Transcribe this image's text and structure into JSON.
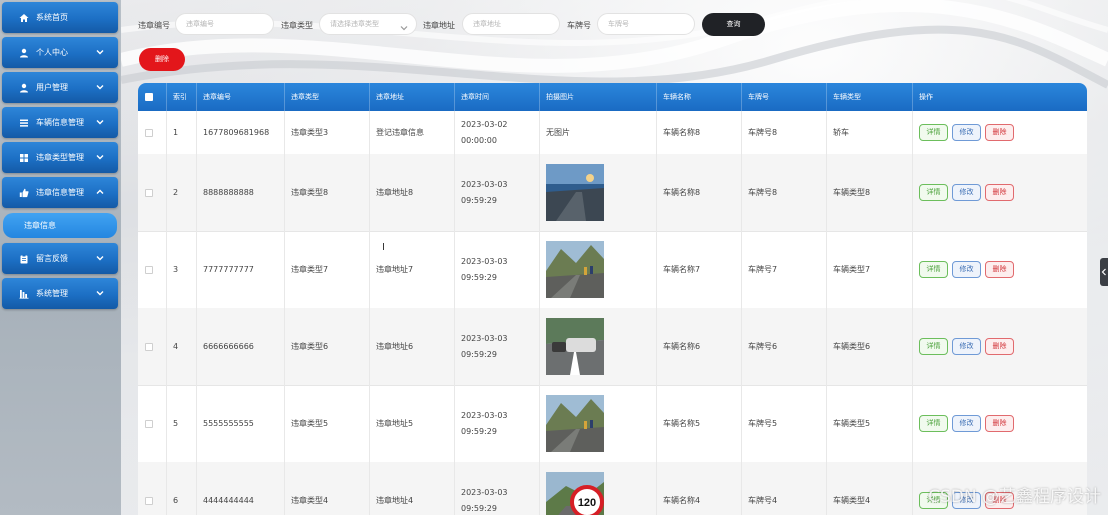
{
  "sidebar": {
    "items": [
      {
        "label": "系统首页",
        "icon": "home-icon",
        "chevron": false
      },
      {
        "label": "个人中心",
        "icon": "user-icon",
        "chevron": "down"
      },
      {
        "label": "用户管理",
        "icon": "user-icon",
        "chevron": "down"
      },
      {
        "label": "车辆信息管理",
        "icon": "list-icon",
        "chevron": "down"
      },
      {
        "label": "违章类型管理",
        "icon": "grid-icon",
        "chevron": "down"
      },
      {
        "label": "违章信息管理",
        "icon": "thumbs-up-icon",
        "chevron": "up"
      },
      {
        "label": "留言反馈",
        "icon": "clipboard-icon",
        "chevron": "down"
      },
      {
        "label": "系统管理",
        "icon": "bar-chart-icon",
        "chevron": "down"
      }
    ],
    "active_sub": "违章信息"
  },
  "filters": {
    "violation_no": {
      "label": "违章编号",
      "placeholder": "违章编号"
    },
    "violation_type": {
      "label": "违章类型",
      "placeholder": "请选择违章类型"
    },
    "violation_address": {
      "label": "违章地址",
      "placeholder": "违章地址"
    },
    "plate_no": {
      "label": "车牌号",
      "placeholder": "车牌号"
    },
    "query_label": "查询"
  },
  "toolbar": {
    "delete_label": "删除"
  },
  "table": {
    "headers": [
      "索引",
      "违章编号",
      "违章类型",
      "违章地址",
      "违章时间",
      "拍摄图片",
      "车辆名称",
      "车牌号",
      "车辆类型",
      "操作"
    ],
    "actions": {
      "detail": "详情",
      "edit": "修改",
      "remove": "删除"
    },
    "rows": [
      {
        "index": "1",
        "no": "1677809681968",
        "type": "违章类型3",
        "address": "登记违章信息",
        "time": "2023-03-02 00:00:00",
        "photo": "无图片",
        "vehicle": "车辆名称8",
        "plate": "车牌号8",
        "vtype": "轿车"
      },
      {
        "index": "2",
        "no": "8888888888",
        "type": "违章类型8",
        "address": "违章地址8",
        "time": "2023-03-03 09:59:29",
        "photo": "road-sunset",
        "vehicle": "车辆名称8",
        "plate": "车牌号8",
        "vtype": "车辆类型8"
      },
      {
        "index": "3",
        "no": "7777777777",
        "type": "违章类型7",
        "address": "违章地址7",
        "time": "2023-03-03 09:59:29",
        "photo": "road-mountain",
        "vehicle": "车辆名称7",
        "plate": "车牌号7",
        "vtype": "车辆类型7"
      },
      {
        "index": "4",
        "no": "6666666666",
        "type": "违章类型6",
        "address": "违章地址6",
        "time": "2023-03-03 09:59:29",
        "photo": "car-accident",
        "vehicle": "车辆名称6",
        "plate": "车牌号6",
        "vtype": "车辆类型6"
      },
      {
        "index": "5",
        "no": "5555555555",
        "type": "违章类型5",
        "address": "违章地址5",
        "time": "2023-03-03 09:59:29",
        "photo": "road-mountain",
        "vehicle": "车辆名称5",
        "plate": "车牌号5",
        "vtype": "车辆类型5"
      },
      {
        "index": "6",
        "no": "4444444444",
        "type": "违章类型4",
        "address": "违章地址4",
        "time": "2023-03-03 09:59:29",
        "photo": "speed-sign-120",
        "vehicle": "车辆名称4",
        "plate": "车牌号4",
        "vtype": "车辆类型4"
      }
    ]
  },
  "speed_sign_value": "120",
  "watermark": "CSDN @艺鑫程序设计",
  "colors": {
    "sidebar_menu": "#1c6fc4",
    "header": "#2b86dc",
    "delete": "#e3161b",
    "query": "#202226"
  }
}
